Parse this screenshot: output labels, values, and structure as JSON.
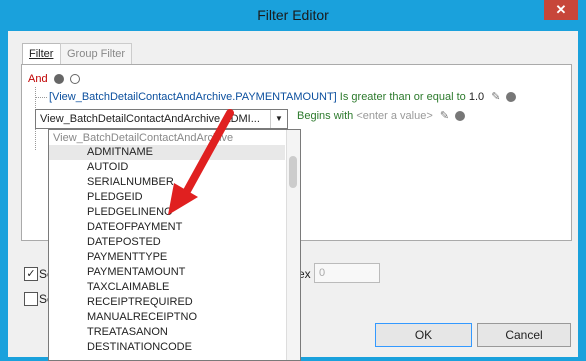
{
  "window": {
    "title": "Filter Editor",
    "close_icon": "close-icon"
  },
  "tabs": [
    {
      "label": "Filter"
    },
    {
      "label": "Group Filter"
    }
  ],
  "filter": {
    "group_op": "And",
    "cond1": {
      "field": "[View_BatchDetailContactAndArchive.PAYMENTAMOUNT]",
      "op": "Is greater than or equal to",
      "value": "1.0"
    },
    "cond2": {
      "field": "View_BatchDetailContactAndArchive.ADMI...",
      "op": "Begins with",
      "value_placeholder": "<enter a value>"
    }
  },
  "dropdown": {
    "header": "View_BatchDetailContactAndArchive",
    "items": [
      "ADMITNAME",
      "AUTOID",
      "SERIALNUMBER",
      "PLEDGEID",
      "PLEDGELINENO",
      "DATEOFPAYMENT",
      "DATEPOSTED",
      "PAYMENTTYPE",
      "PAYMENTAMOUNT",
      "TAXCLAIMABLE",
      "RECEIPTREQUIRED",
      "MANUALRECEIPTNO",
      "TREATASANON",
      "DESTINATIONCODE"
    ],
    "selected": "ADMITNAME"
  },
  "options": {
    "label1": "Se",
    "label2": "Se",
    "max_label": "ex",
    "max_value": "0"
  },
  "buttons": {
    "ok": "OK",
    "cancel": "Cancel"
  },
  "colors": {
    "titlebar": "#1aa1dc",
    "and": "#c00000",
    "field": "#0b4f9e",
    "operator": "#2c7a2c",
    "arrow": "#e02020"
  }
}
